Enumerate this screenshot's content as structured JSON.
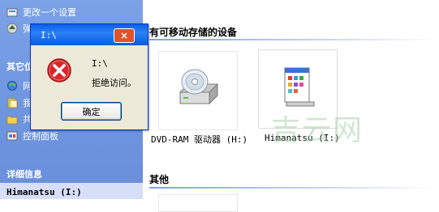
{
  "left_pane": {
    "top_items": [
      {
        "label": "更改一个设置",
        "icon": "settings-icon"
      },
      {
        "label": "弹出此盘",
        "icon": "eject-icon"
      }
    ],
    "other_places": {
      "title": "其它位",
      "items": [
        {
          "label": "网",
          "icon": "network-icon"
        },
        {
          "label": "我的",
          "icon": "documents-icon"
        },
        {
          "label": "共享",
          "icon": "shared-folder-icon"
        },
        {
          "label": "控制面板",
          "icon": "control-panel-icon"
        }
      ]
    },
    "details": {
      "title": "详细信息",
      "drive_name": "Himanatsu (I:)"
    }
  },
  "content": {
    "removable_header": "有可移动存储的设备",
    "devices": [
      {
        "label": "DVD-RAM 驱动器 (H:)",
        "icon": "dvd-drive-icon"
      },
      {
        "label": "Himanatsu (I:)",
        "icon": "drive-icon"
      }
    ],
    "other_header": "其他"
  },
  "watermark": "吉云网",
  "dialog": {
    "title": "I:\\",
    "close_label": "×",
    "message_path": "I:\\",
    "message": "拒绝访问。",
    "ok_label": "确定",
    "icon": "error-icon"
  }
}
